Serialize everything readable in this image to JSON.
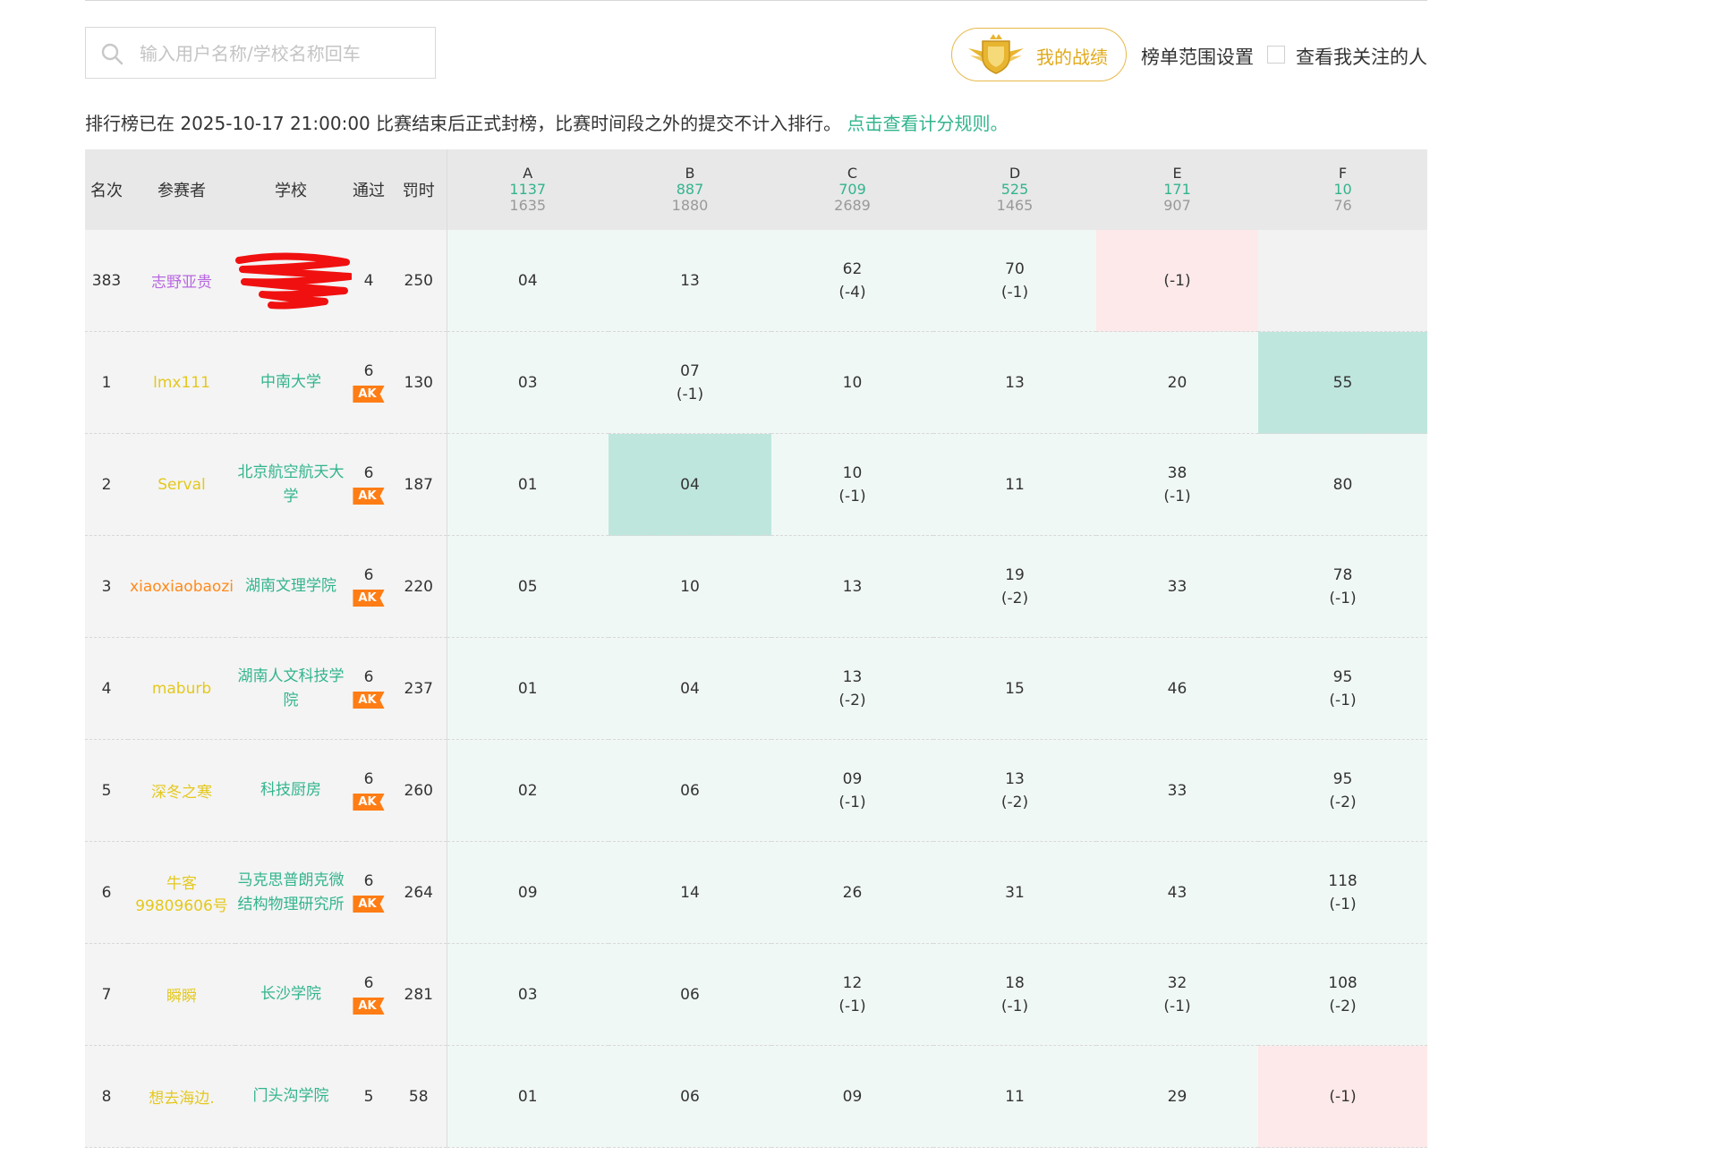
{
  "search": {
    "placeholder": "输入用户名称/学校名称回车",
    "icon": "search-icon"
  },
  "toolbar": {
    "my_record": "我的战绩",
    "range_settings": "榜单范围设置",
    "follow_label": "查看我关注的人",
    "follow_checked": false
  },
  "notice": {
    "text": "排行榜已在 2025-10-17 21:00:00 比赛结束后正式封榜，比赛时间段之外的提交不计入排行。",
    "link": "点击查看计分规则。"
  },
  "table": {
    "headers": {
      "rank": "名次",
      "user": "参赛者",
      "school": "学校",
      "solved": "通过",
      "penalty": "罚时"
    },
    "problems": [
      {
        "letter": "A",
        "accepted": "1137",
        "total": "1635"
      },
      {
        "letter": "B",
        "accepted": "887",
        "total": "1880"
      },
      {
        "letter": "C",
        "accepted": "709",
        "total": "2689"
      },
      {
        "letter": "D",
        "accepted": "525",
        "total": "1465"
      },
      {
        "letter": "E",
        "accepted": "171",
        "total": "907"
      },
      {
        "letter": "F",
        "accepted": "10",
        "total": "76"
      }
    ],
    "rows": [
      {
        "rank": "383",
        "user": "志野亚贵",
        "user_color": "#b968e0",
        "school": "",
        "school_redacted": true,
        "solved": "4",
        "ak": "",
        "penalty": "250",
        "cells": [
          {
            "t": "04",
            "p": "",
            "s": "ac"
          },
          {
            "t": "13",
            "p": "",
            "s": "ac"
          },
          {
            "t": "62",
            "p": "(-4)",
            "s": "ac"
          },
          {
            "t": "70",
            "p": "(-1)",
            "s": "ac"
          },
          {
            "t": "",
            "p": "(-1)",
            "s": "fail"
          },
          {
            "t": "",
            "p": "",
            "s": "none"
          }
        ]
      },
      {
        "rank": "1",
        "user": "lmx111",
        "user_color": "#e4c81e",
        "school": "中南大学",
        "solved": "6",
        "ak": "AK",
        "penalty": "130",
        "cells": [
          {
            "t": "03",
            "p": "",
            "s": "ac"
          },
          {
            "t": "07",
            "p": "(-1)",
            "s": "ac"
          },
          {
            "t": "10",
            "p": "",
            "s": "ac"
          },
          {
            "t": "13",
            "p": "",
            "s": "ac"
          },
          {
            "t": "20",
            "p": "",
            "s": "ac"
          },
          {
            "t": "55",
            "p": "",
            "s": "fb"
          }
        ]
      },
      {
        "rank": "2",
        "user": "Serval",
        "user_color": "#e4c81e",
        "school": "北京航空航天大学",
        "solved": "6",
        "ak": "AK",
        "penalty": "187",
        "cells": [
          {
            "t": "01",
            "p": "",
            "s": "ac"
          },
          {
            "t": "04",
            "p": "",
            "s": "fb"
          },
          {
            "t": "10",
            "p": "(-1)",
            "s": "ac"
          },
          {
            "t": "11",
            "p": "",
            "s": "ac"
          },
          {
            "t": "38",
            "p": "(-1)",
            "s": "ac"
          },
          {
            "t": "80",
            "p": "",
            "s": "ac"
          }
        ]
      },
      {
        "rank": "3",
        "user": "xiaoxiaobaozi",
        "user_color": "#ff8a1a",
        "school": "湖南文理学院",
        "solved": "6",
        "ak": "AK",
        "penalty": "220",
        "cells": [
          {
            "t": "05",
            "p": "",
            "s": "ac"
          },
          {
            "t": "10",
            "p": "",
            "s": "ac"
          },
          {
            "t": "13",
            "p": "",
            "s": "ac"
          },
          {
            "t": "19",
            "p": "(-2)",
            "s": "ac"
          },
          {
            "t": "33",
            "p": "",
            "s": "ac"
          },
          {
            "t": "78",
            "p": "(-1)",
            "s": "ac"
          }
        ]
      },
      {
        "rank": "4",
        "user": "maburb",
        "user_color": "#e4c81e",
        "school": "湖南人文科技学院",
        "solved": "6",
        "ak": "AK",
        "penalty": "237",
        "cells": [
          {
            "t": "01",
            "p": "",
            "s": "ac"
          },
          {
            "t": "04",
            "p": "",
            "s": "ac"
          },
          {
            "t": "13",
            "p": "(-2)",
            "s": "ac"
          },
          {
            "t": "15",
            "p": "",
            "s": "ac"
          },
          {
            "t": "46",
            "p": "",
            "s": "ac"
          },
          {
            "t": "95",
            "p": "(-1)",
            "s": "ac"
          }
        ]
      },
      {
        "rank": "5",
        "user": "深冬之寒",
        "user_color": "#e4c81e",
        "school": "科技厨房",
        "solved": "6",
        "ak": "AK",
        "penalty": "260",
        "cells": [
          {
            "t": "02",
            "p": "",
            "s": "ac"
          },
          {
            "t": "06",
            "p": "",
            "s": "ac"
          },
          {
            "t": "09",
            "p": "(-1)",
            "s": "ac"
          },
          {
            "t": "13",
            "p": "(-2)",
            "s": "ac"
          },
          {
            "t": "33",
            "p": "",
            "s": "ac"
          },
          {
            "t": "95",
            "p": "(-2)",
            "s": "ac"
          }
        ]
      },
      {
        "rank": "6",
        "user": "牛客99809606号",
        "user_color": "#e4c81e",
        "school": "马克思普朗克微结构物理研究所",
        "solved": "6",
        "ak": "AK",
        "penalty": "264",
        "cells": [
          {
            "t": "09",
            "p": "",
            "s": "ac"
          },
          {
            "t": "14",
            "p": "",
            "s": "ac"
          },
          {
            "t": "26",
            "p": "",
            "s": "ac"
          },
          {
            "t": "31",
            "p": "",
            "s": "ac"
          },
          {
            "t": "43",
            "p": "",
            "s": "ac"
          },
          {
            "t": "118",
            "p": "(-1)",
            "s": "ac"
          }
        ]
      },
      {
        "rank": "7",
        "user": "瞬瞬",
        "user_color": "#e4c81e",
        "school": "长沙学院",
        "solved": "6",
        "ak": "AK",
        "penalty": "281",
        "cells": [
          {
            "t": "03",
            "p": "",
            "s": "ac"
          },
          {
            "t": "06",
            "p": "",
            "s": "ac"
          },
          {
            "t": "12",
            "p": "(-1)",
            "s": "ac"
          },
          {
            "t": "18",
            "p": "(-1)",
            "s": "ac"
          },
          {
            "t": "32",
            "p": "(-1)",
            "s": "ac"
          },
          {
            "t": "108",
            "p": "(-2)",
            "s": "ac"
          }
        ]
      },
      {
        "rank": "8",
        "user": "想去海边.",
        "user_color": "#e4c81e",
        "school": "门头沟学院",
        "solved": "5",
        "ak": "",
        "penalty": "58",
        "cells": [
          {
            "t": "01",
            "p": "",
            "s": "ac"
          },
          {
            "t": "06",
            "p": "",
            "s": "ac"
          },
          {
            "t": "09",
            "p": "",
            "s": "ac"
          },
          {
            "t": "11",
            "p": "",
            "s": "ac"
          },
          {
            "t": "29",
            "p": "",
            "s": "ac"
          },
          {
            "t": "",
            "p": "(-1)",
            "s": "fail"
          }
        ]
      }
    ]
  }
}
